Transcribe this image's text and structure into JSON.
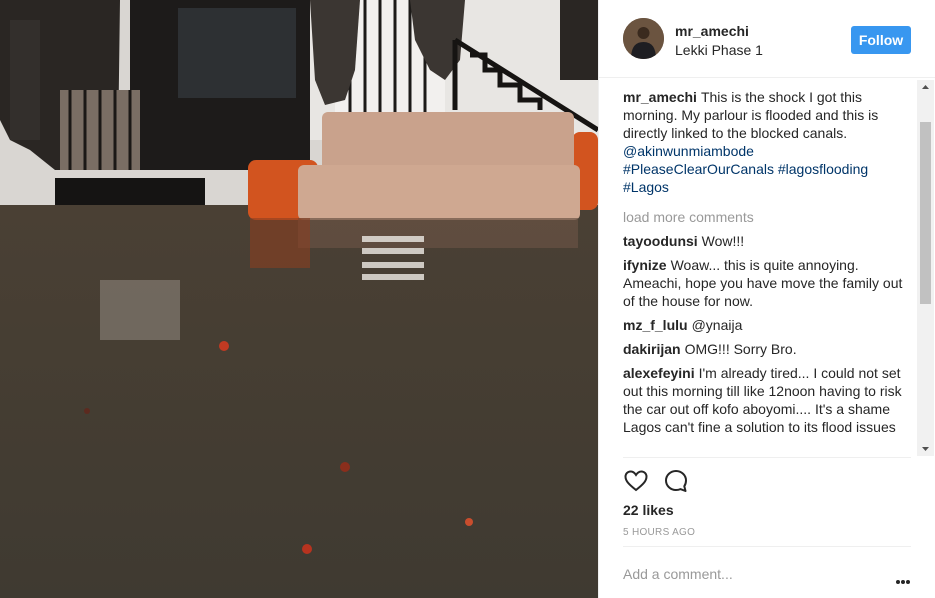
{
  "post": {
    "username": "mr_amechi",
    "location": "Lekki Phase 1",
    "follow_label": "Follow",
    "caption": {
      "author": "mr_amechi",
      "text": "This is the shock I got this morning. My parlour is flooded and this is directly linked to the blocked canals.",
      "mention": "@akinwunmiambode",
      "tags": "#PleaseClearOurCanals #lagosflooding #Lagos"
    },
    "load_more_label": "load more comments",
    "comments": [
      {
        "author": "tayoodunsi",
        "text": "Wow!!!"
      },
      {
        "author": "ifynize",
        "text": "Woaw... this is quite annoying. Ameachi, hope you have move the family out of the house for now."
      },
      {
        "author": "mz_f_lulu",
        "text": "@ynaija"
      },
      {
        "author": "dakirijan",
        "text": "OMG!!! Sorry Bro."
      },
      {
        "author": "alexefeyini",
        "text": "I'm already tired... I could not set out this morning till like 12noon having to risk the car out off kofo aboyomi.... It's a shame Lagos can't fine a solution to its flood issues"
      }
    ],
    "likes": "22 likes",
    "time": "5 HOURS AGO",
    "add_comment_placeholder": "Add a comment...",
    "icons": {
      "like": "heart-icon",
      "comment": "comment-bubble-icon",
      "more": "more-options-icon"
    },
    "colors": {
      "follow_button": "#3897f0",
      "link": "#003569",
      "muted": "#999999"
    }
  }
}
